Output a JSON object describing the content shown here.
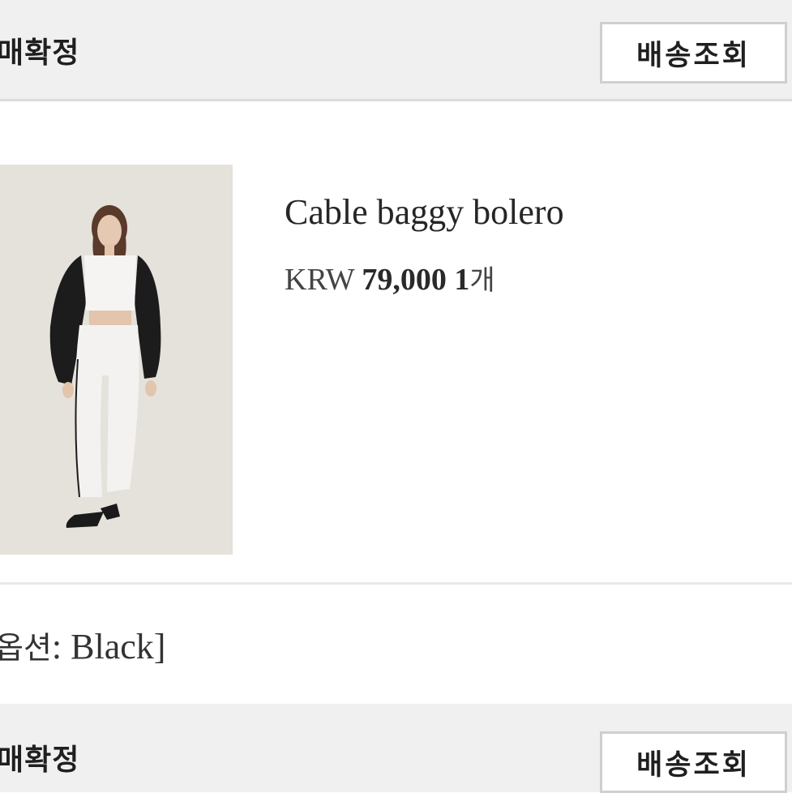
{
  "order_1": {
    "status": "매확정",
    "track_button": "배송조회"
  },
  "product": {
    "image_alt": "model wearing black cable knit bolero with white crop top and white jogger pants",
    "name": "Cable baggy bolero",
    "currency": "KRW",
    "price": "79,000",
    "quantity": "1",
    "quantity_unit": "개"
  },
  "option": {
    "prefix": "옵션",
    "separator": ": ",
    "value": "Black",
    "suffix": "]"
  },
  "order_2": {
    "status": "매확정",
    "track_button": "배송조회"
  },
  "colors": {
    "header_bg": "#f0f0f0",
    "button_border": "#cfcfcf"
  }
}
